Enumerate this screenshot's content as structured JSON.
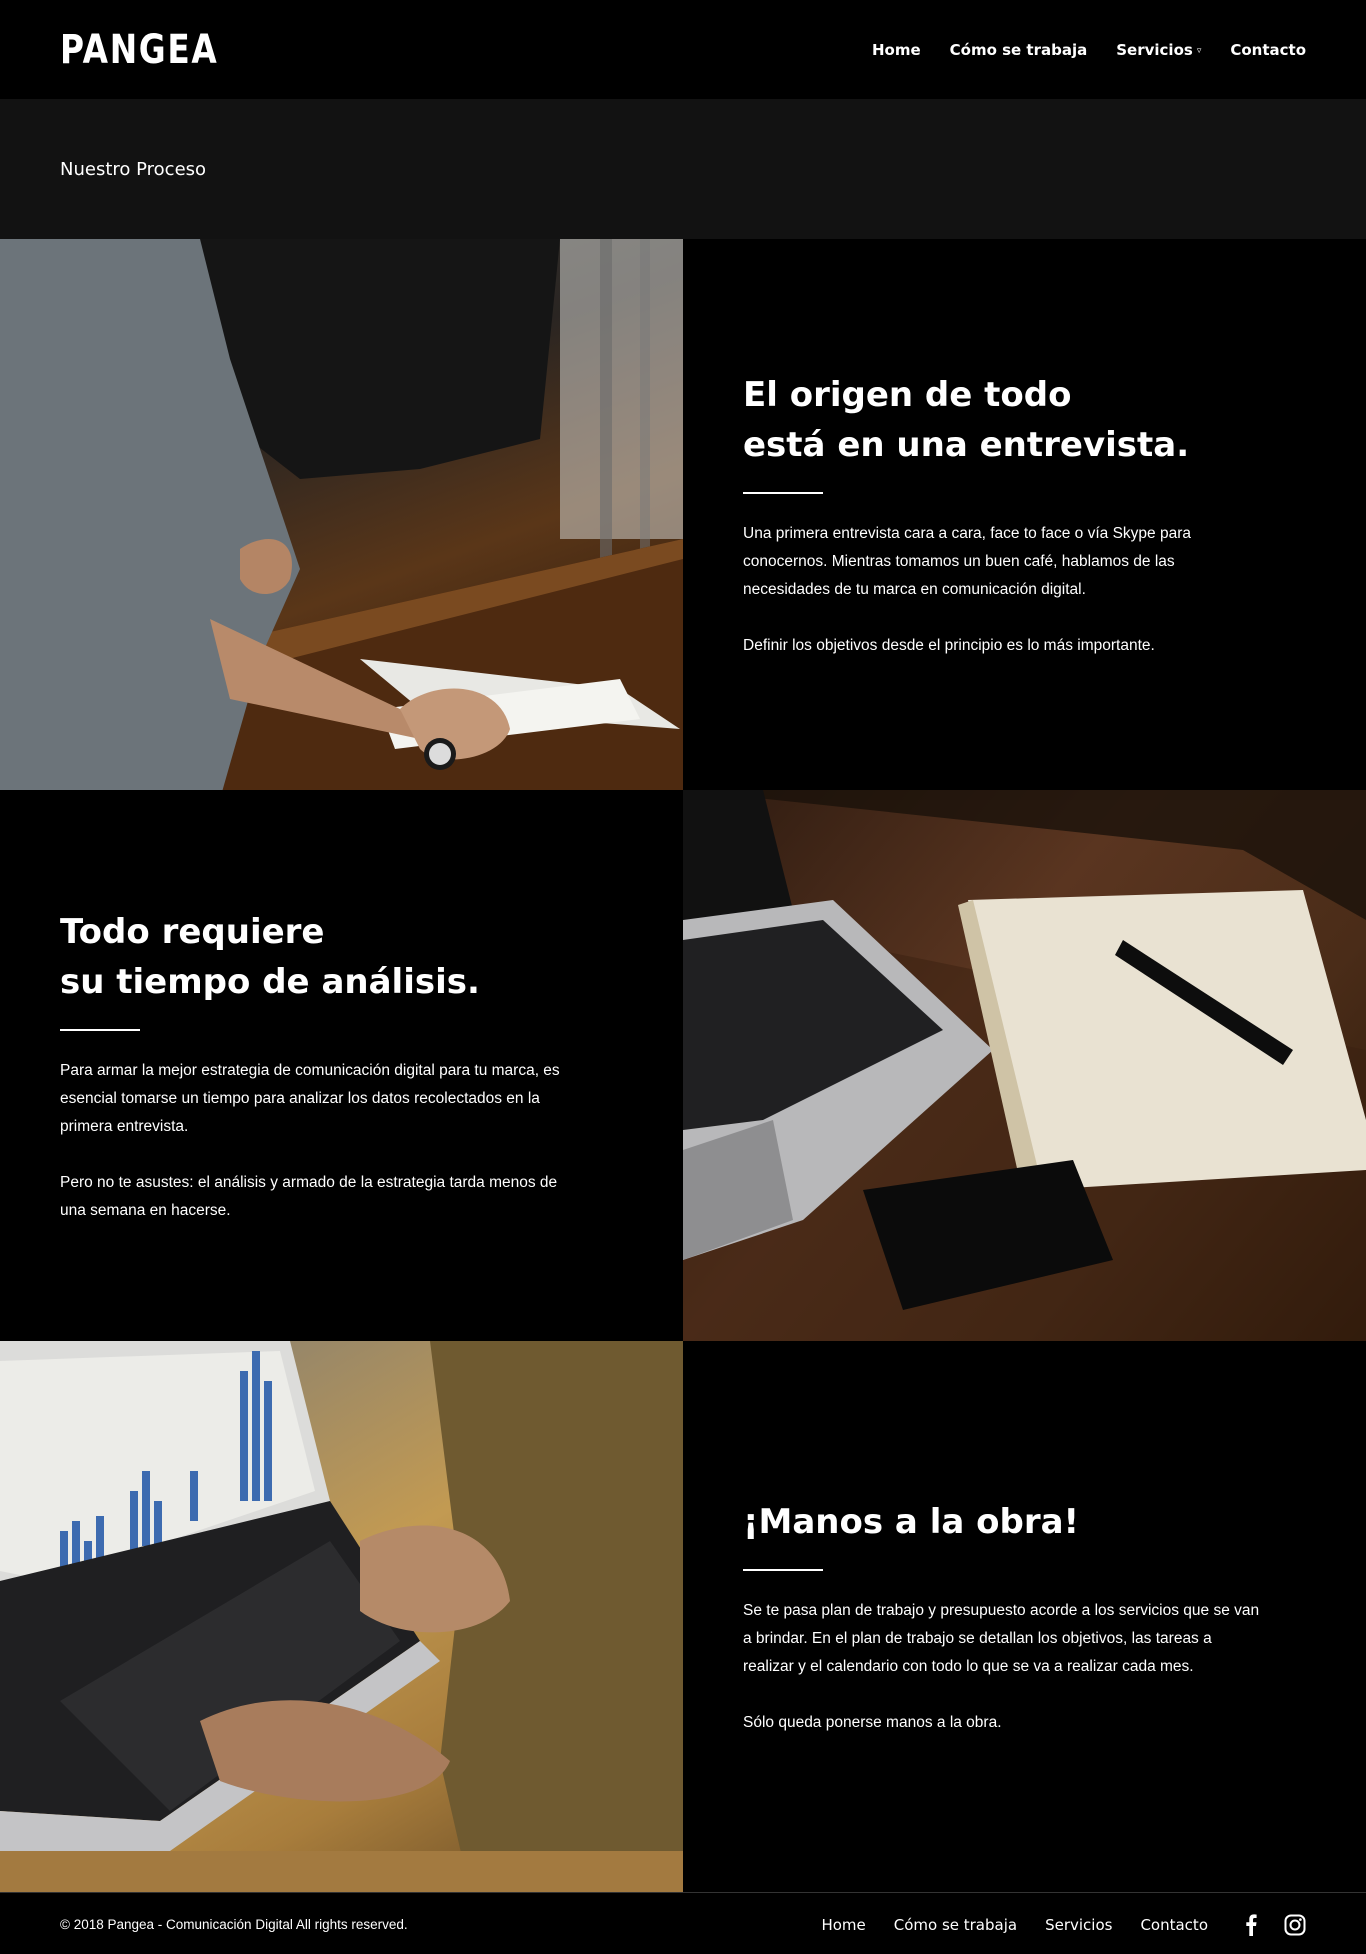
{
  "header": {
    "logo": "PANGEA",
    "nav": [
      {
        "label": "Home"
      },
      {
        "label": "Cómo se trabaja"
      },
      {
        "label": "Servicios"
      },
      {
        "label": "Contacto"
      }
    ]
  },
  "title_bar": {
    "title": "Nuestro Proceso"
  },
  "sections": [
    {
      "title_line1": "El origen de todo",
      "title_line2": "está en una entrevista.",
      "paragraphs": [
        "Una primera entrevista cara a cara, face to face o vía Skype para conocernos. Mientras tomamos un buen café, hablamos de las necesidades de tu marca en comunicación digital.",
        "Definir los objetivos desde el principio es lo más importante."
      ]
    },
    {
      "title_line1": "Todo requiere",
      "title_line2": "su tiempo de análisis.",
      "paragraphs": [
        "Para armar la mejor estrategia de comunicación digital para tu marca, es esencial tomarse un tiempo para analizar los datos recolectados en la primera entrevista.",
        "Pero no te asustes: el análisis y armado de la estrategia tarda menos de una semana en hacerse."
      ]
    },
    {
      "title_line1": "¡Manos a la obra!",
      "paragraphs": [
        "Se te pasa plan de trabajo y presupuesto acorde a los servicios que se van a brindar. En el plan de trabajo se detallan los objetivos, las tareas a realizar y el calendario con todo lo que se va a realizar cada mes.",
        "Sólo queda ponerse manos a la obra."
      ]
    }
  ],
  "footer": {
    "copyright": "© 2018 Pangea - Comunicación Digital All rights reserved.",
    "nav": [
      {
        "label": "Home"
      },
      {
        "label": "Cómo se trabaja"
      },
      {
        "label": "Servicios"
      },
      {
        "label": "Contacto"
      }
    ],
    "social": [
      {
        "icon": "facebook-icon"
      },
      {
        "icon": "instagram-icon"
      }
    ]
  }
}
